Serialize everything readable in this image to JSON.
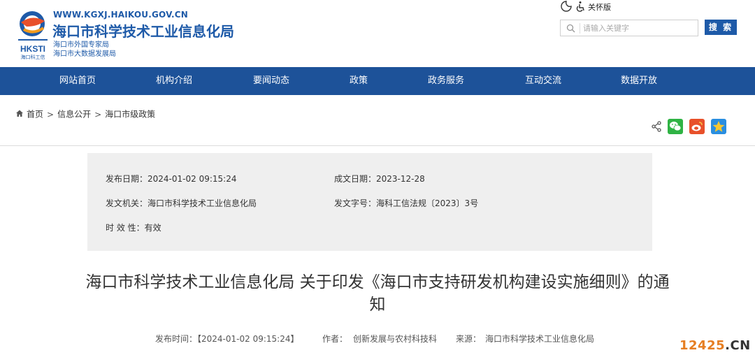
{
  "header": {
    "url": "WWW.KGXJ.HAIKOU.GOV.CN",
    "site_name": "海口市科学技术工业信息化局",
    "sub_name_1": "海口市外国专家局",
    "sub_name_2": "海口市大数据发展局",
    "logo_text": "HKSTI",
    "logo_caption": "海口科工信",
    "brand_color": "#1e5aa8"
  },
  "tools": {
    "accessibility_label": "关怀版",
    "contrast_icon": "contrast-icon",
    "accessibility_icon": "wheelchair-icon"
  },
  "search": {
    "placeholder": "请输入关键字",
    "button_label": "搜 索"
  },
  "nav": {
    "background": "#1d5299",
    "items": [
      "网站首页",
      "机构介绍",
      "要闻动态",
      "政策",
      "政务服务",
      "互动交流",
      "数据开放"
    ]
  },
  "breadcrumb": {
    "items": [
      "首页",
      "信息公开",
      "海口市级政策"
    ],
    "separator": ">"
  },
  "share": {
    "icons": [
      "share-icon",
      "wechat-icon",
      "weibo-icon",
      "qzone-icon"
    ]
  },
  "meta": {
    "publish_date_label": "发布日期：",
    "publish_date": "2024-01-02 09:15:24",
    "created_date_label": "成文日期：",
    "created_date": "2023-12-28",
    "issuer_label": "发文机关：",
    "issuer": "海口市科学技术工业信息化局",
    "doc_no_label": "发文字号：",
    "doc_no": "海科工信法规〔2023〕3号",
    "validity_label": "时 效 性：",
    "validity": "有效"
  },
  "document": {
    "title": "海口市科学技术工业信息化局 关于印发《海口市支持研发机构建设实施细则》的通知",
    "publish_time_label": "发布时间：",
    "publish_time": "【2024-01-02 09:15:24】",
    "author_label": "作者：",
    "author": "创新发展与农村科技科",
    "source_label": "来源：",
    "source": "海口市科学技术工业信息化局"
  },
  "watermark": {
    "num": "12425",
    "dot": ".",
    "tld": "CN"
  }
}
